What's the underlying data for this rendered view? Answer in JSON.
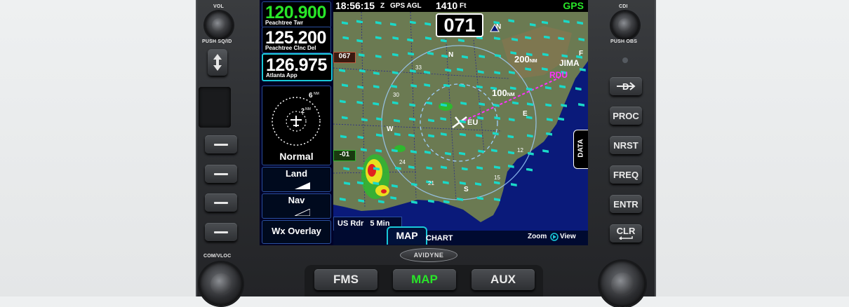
{
  "knobs": {
    "left_top_label": "VOL",
    "left_top_sub": "PUSH SQ/ID",
    "left_bottom_label": "COM/VLOC",
    "right_top_label": "CDI",
    "right_top_sub": "PUSH OBS"
  },
  "com_radio": {
    "active_freq": "120.900",
    "active_name": "Peachtree Twr",
    "standby_freq": "125.200",
    "standby_name": "Peachtree Clnc Del",
    "nav_freq": "126.975",
    "nav_name": "Atlanta App"
  },
  "left_panel": {
    "range_outer": "6",
    "range_inner": "2",
    "range_unit": "NM",
    "mode_label": "Normal",
    "land_label": "Land",
    "nav_label": "Nav",
    "wx_overlay_label": "Wx Overlay"
  },
  "top_bar": {
    "time": "18:56:15",
    "time_zone": "Z",
    "altitude_label": "GPS AGL",
    "altitude_value": "1410",
    "altitude_unit": "Ft",
    "nav_source": "GPS"
  },
  "map": {
    "heading": "071",
    "north_label": "N",
    "range_200": "200",
    "range_100": "100",
    "range_unit": "NM",
    "waypoint_1": "RDU",
    "waypoint_2": "JIMA",
    "heading_box_left": "067",
    "tag_minus01": "-01",
    "airport_label": "EU",
    "compass_w": "W",
    "compass_e": "E",
    "compass_s": "S",
    "compass_n": "N",
    "compass_f": "F",
    "tick_33": "33",
    "tick_30": "30",
    "tick_24": "24",
    "tick_21": "21",
    "tick_15": "15",
    "tick_12": "12",
    "radar_label": "US Rdr",
    "radar_age": "5 Min",
    "data_tab": "DATA"
  },
  "bottom_tabs": {
    "map_tab": "MAP",
    "chart_tab": "CHART",
    "zoom_label": "Zoom",
    "view_label": "View"
  },
  "brand": "AVIDYNE",
  "right_buttons": {
    "direct_to": "D",
    "proc": "PROC",
    "nrst": "NRST",
    "freq": "FREQ",
    "entr": "ENTR",
    "clr": "CLR"
  },
  "bottom_buttons": {
    "fms": "FMS",
    "map": "MAP",
    "aux": "AUX"
  },
  "colors": {
    "active_green": "#28e628",
    "highlight_cyan": "#19c8d8",
    "route_magenta": "#ff30ff",
    "land_color": "#6b7a52",
    "water_color": "#0a1a7a",
    "wind_barb": "#1ad9c8"
  }
}
